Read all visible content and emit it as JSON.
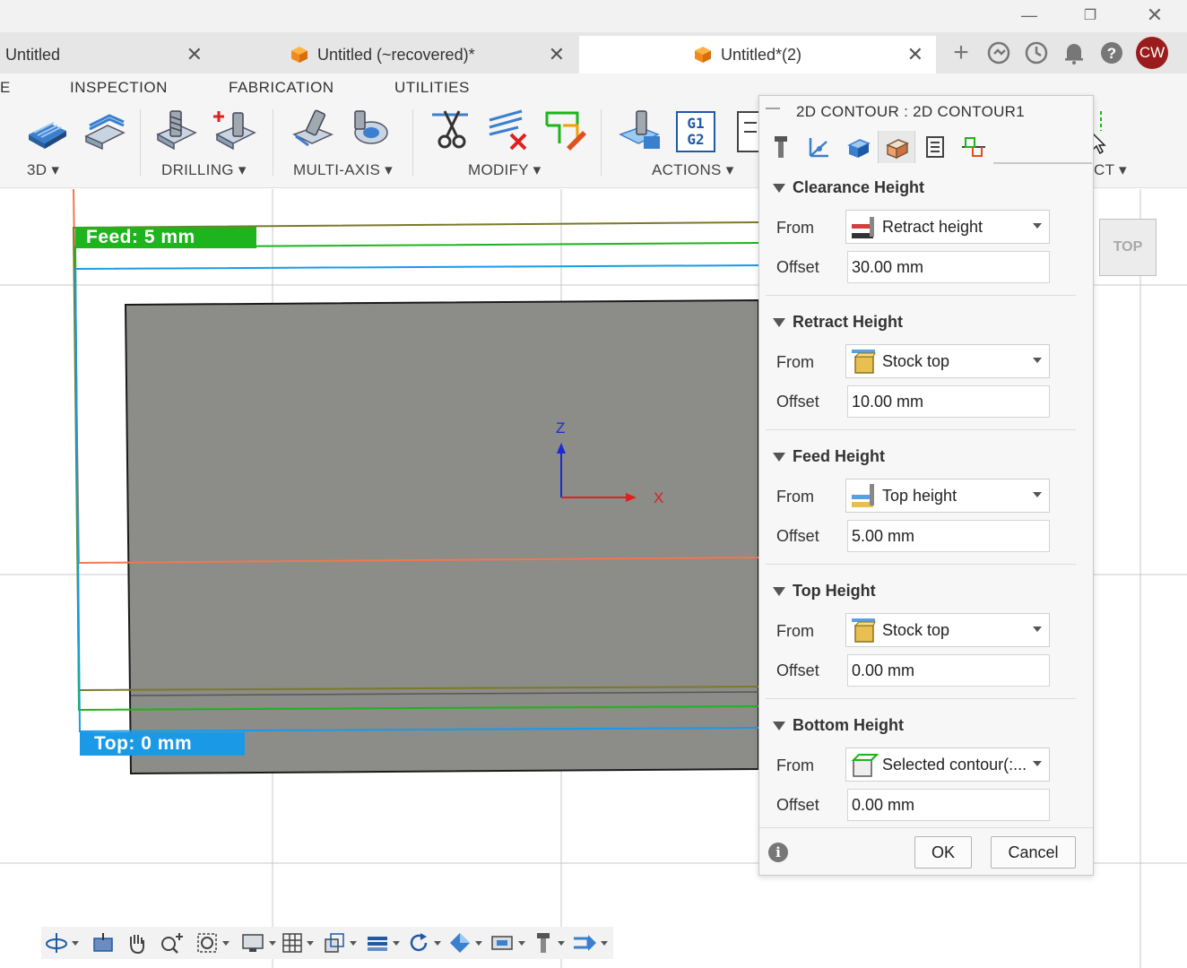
{
  "window": {
    "minimize_glyph": "—",
    "restore_glyph": "❐",
    "close_glyph": "✕"
  },
  "tabs": [
    {
      "label": "Untitled",
      "close": "✕"
    },
    {
      "label": "Untitled (~recovered)*",
      "close": "✕"
    },
    {
      "label": "Untitled*(2)",
      "close": "✕"
    }
  ],
  "top_icons": {
    "add": "+",
    "user_initials": "CW"
  },
  "ribbon": {
    "tabs": [
      "E",
      "INSPECTION",
      "FABRICATION",
      "UTILITIES"
    ],
    "groups": {
      "g3d": "3D",
      "drilling": "DRILLING",
      "multiaxis": "MULTI-AXIS",
      "modify": "MODIFY",
      "actions": "ACTIONS",
      "clipped": "CT"
    },
    "gcode_lines": [
      "G1",
      "G2"
    ]
  },
  "viewport": {
    "feed_label": "Feed: 5 mm",
    "top_label": "Top: 0 mm",
    "axis_z": "Z",
    "axis_x": "X",
    "viewcube_face": "TOP"
  },
  "dialog": {
    "collapse_glyph": "—",
    "title": "2D CONTOUR : 2D CONTOUR1",
    "sections": {
      "clearance": {
        "heading": "Clearance Height",
        "from_label": "From",
        "from_value": "Retract height",
        "offset_label": "Offset",
        "offset_value": "30.00 mm"
      },
      "retract": {
        "heading": "Retract Height",
        "from_label": "From",
        "from_value": "Stock top",
        "offset_label": "Offset",
        "offset_value": "10.00 mm"
      },
      "feed": {
        "heading": "Feed Height",
        "from_label": "From",
        "from_value": "Top height",
        "offset_label": "Offset",
        "offset_value": "5.00 mm"
      },
      "top": {
        "heading": "Top Height",
        "from_label": "From",
        "from_value": "Stock top",
        "offset_label": "Offset",
        "offset_value": "0.00 mm"
      },
      "bottom": {
        "heading": "Bottom Height",
        "from_label": "From",
        "from_value": "Selected contour(:...",
        "offset_label": "Offset",
        "offset_value": "0.00 mm"
      }
    },
    "info_glyph": "i",
    "ok_label": "OK",
    "cancel_label": "Cancel"
  },
  "colors": {
    "feed_green": "#1db41d",
    "top_blue": "#1a9ae6",
    "clearance_olive": "#7a7a2a",
    "retract_orange": "#f07850",
    "stock_gray": "#8c8c88",
    "avatar_red": "#9b1c1c"
  }
}
